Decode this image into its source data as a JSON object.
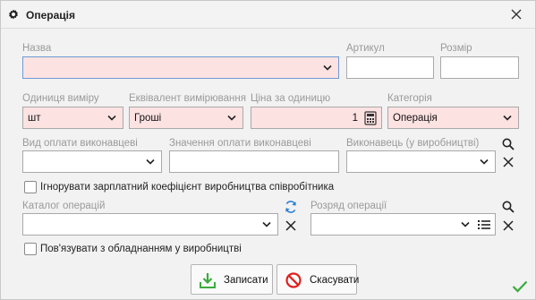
{
  "window": {
    "title": "Операція",
    "icon": "gear-icon",
    "close_icon": "close-icon"
  },
  "fields": {
    "name": {
      "label": "Назва",
      "value": ""
    },
    "article": {
      "label": "Артикул",
      "value": ""
    },
    "size": {
      "label": "Розмір",
      "value": ""
    },
    "unit": {
      "label": "Одиниця виміру",
      "value": "шт"
    },
    "equivalent": {
      "label": "Еквівалент вимірювання",
      "value": "Гроші"
    },
    "price": {
      "label": "Ціна за одиницю",
      "value": "1"
    },
    "category": {
      "label": "Категорія",
      "value": "Операція"
    },
    "pay_type": {
      "label": "Вид оплати виконавцеві",
      "value": ""
    },
    "pay_value": {
      "label": "Значення оплати виконавцеві",
      "value": ""
    },
    "performer": {
      "label": "Виконавець (у виробництві)",
      "value": ""
    },
    "catalog": {
      "label": "Каталог операцій",
      "value": ""
    },
    "grade": {
      "label": "Розряд операції",
      "value": ""
    }
  },
  "checkboxes": {
    "ignore_salary": {
      "label": "Ігнорувати зарплатний коефіцієнт виробництва співробітника",
      "checked": false
    },
    "link_equipment": {
      "label": "Пов'язувати з обладнанням у виробництві",
      "checked": false
    }
  },
  "buttons": {
    "save": {
      "label": "Записати",
      "icon": "save-download-icon"
    },
    "cancel": {
      "label": "Скасувати",
      "icon": "cancel-circle-icon"
    }
  },
  "colors": {
    "required_bg": "#fde2e2",
    "focus_border": "#6e9bd6",
    "label": "#9a9a9a",
    "save_green": "#3bab3e",
    "cancel_red": "#e02020",
    "refresh_blue": "#2a7fd4"
  }
}
